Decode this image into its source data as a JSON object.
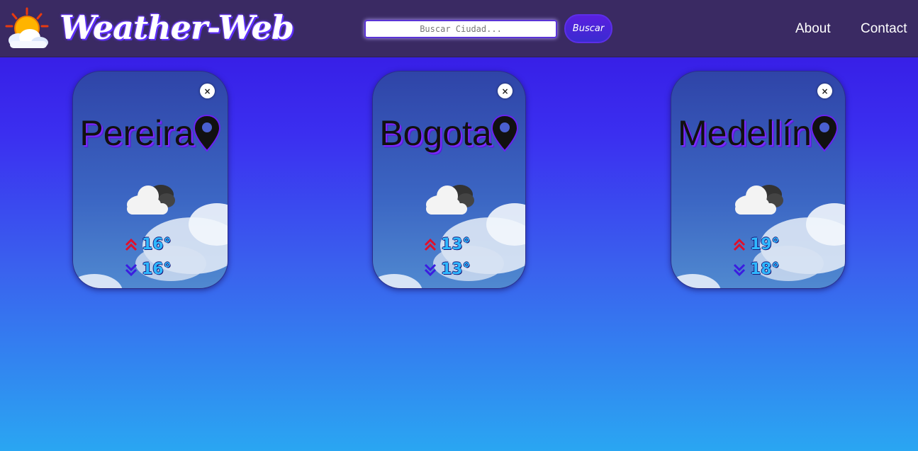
{
  "app": {
    "title": "Weather-Web"
  },
  "search": {
    "placeholder": "Buscar Ciudad...",
    "value": "",
    "button_label": "Buscar"
  },
  "nav": {
    "links": [
      {
        "label": "About"
      },
      {
        "label": "Contact"
      }
    ]
  },
  "cards": [
    {
      "city": "Pereira",
      "condition_icon": "cloudy-icon",
      "max": "16°",
      "min": "16°",
      "close_label": "×"
    },
    {
      "city": "Bogota",
      "condition_icon": "cloudy-icon",
      "max": "13°",
      "min": "13°",
      "close_label": "×"
    },
    {
      "city": "Medellín",
      "condition_icon": "cloudy-icon",
      "max": "19°",
      "min": "18°",
      "close_label": "×"
    }
  ],
  "colors": {
    "navbar": "#3a2a63",
    "accent": "#5a1fe0",
    "temp_text": "#2fb8ff",
    "max_arrow": "#e0102c",
    "min_arrow": "#3b1de0"
  }
}
